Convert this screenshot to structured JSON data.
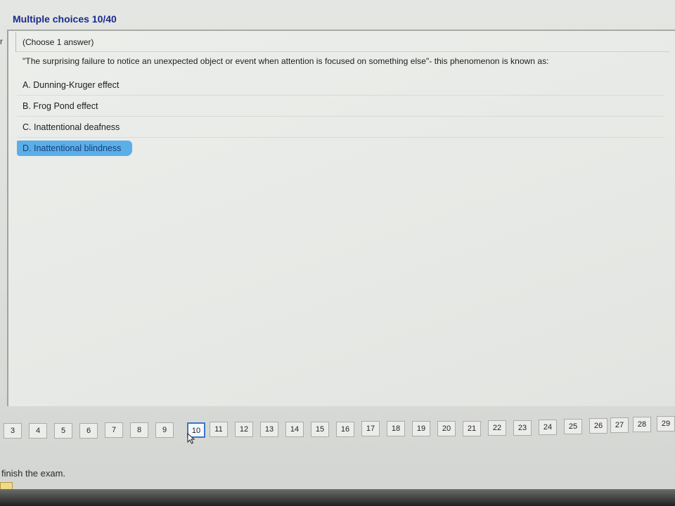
{
  "header": {
    "title": "Multiple choices 10/40"
  },
  "left_mark": "r",
  "question": {
    "instruction": "(Choose 1 answer)",
    "text": "\"The surprising failure to notice an unexpected object or event when attention is focused on something else\"- this phenomenon is known as:",
    "answers": [
      {
        "label": "A. Dunning-Kruger effect",
        "selected": false
      },
      {
        "label": "B. Frog Pond effect",
        "selected": false
      },
      {
        "label": "C. Inattentional deafness",
        "selected": false
      },
      {
        "label": "D. Inattentional blindness",
        "selected": true
      }
    ]
  },
  "navigation": {
    "pages": [
      "3",
      "4",
      "5",
      "6",
      "7",
      "8",
      "9",
      "10",
      "11",
      "12",
      "13",
      "14",
      "15",
      "16",
      "17",
      "18",
      "19",
      "20",
      "21",
      "22",
      "23",
      "24",
      "25",
      "26",
      "27",
      "28",
      "29"
    ],
    "current": "10"
  },
  "footer": {
    "finish_text": "finish the exam."
  },
  "colors": {
    "title": "#1a2a8c",
    "highlight": "#5aafe8",
    "current_border": "#3b78c3"
  }
}
